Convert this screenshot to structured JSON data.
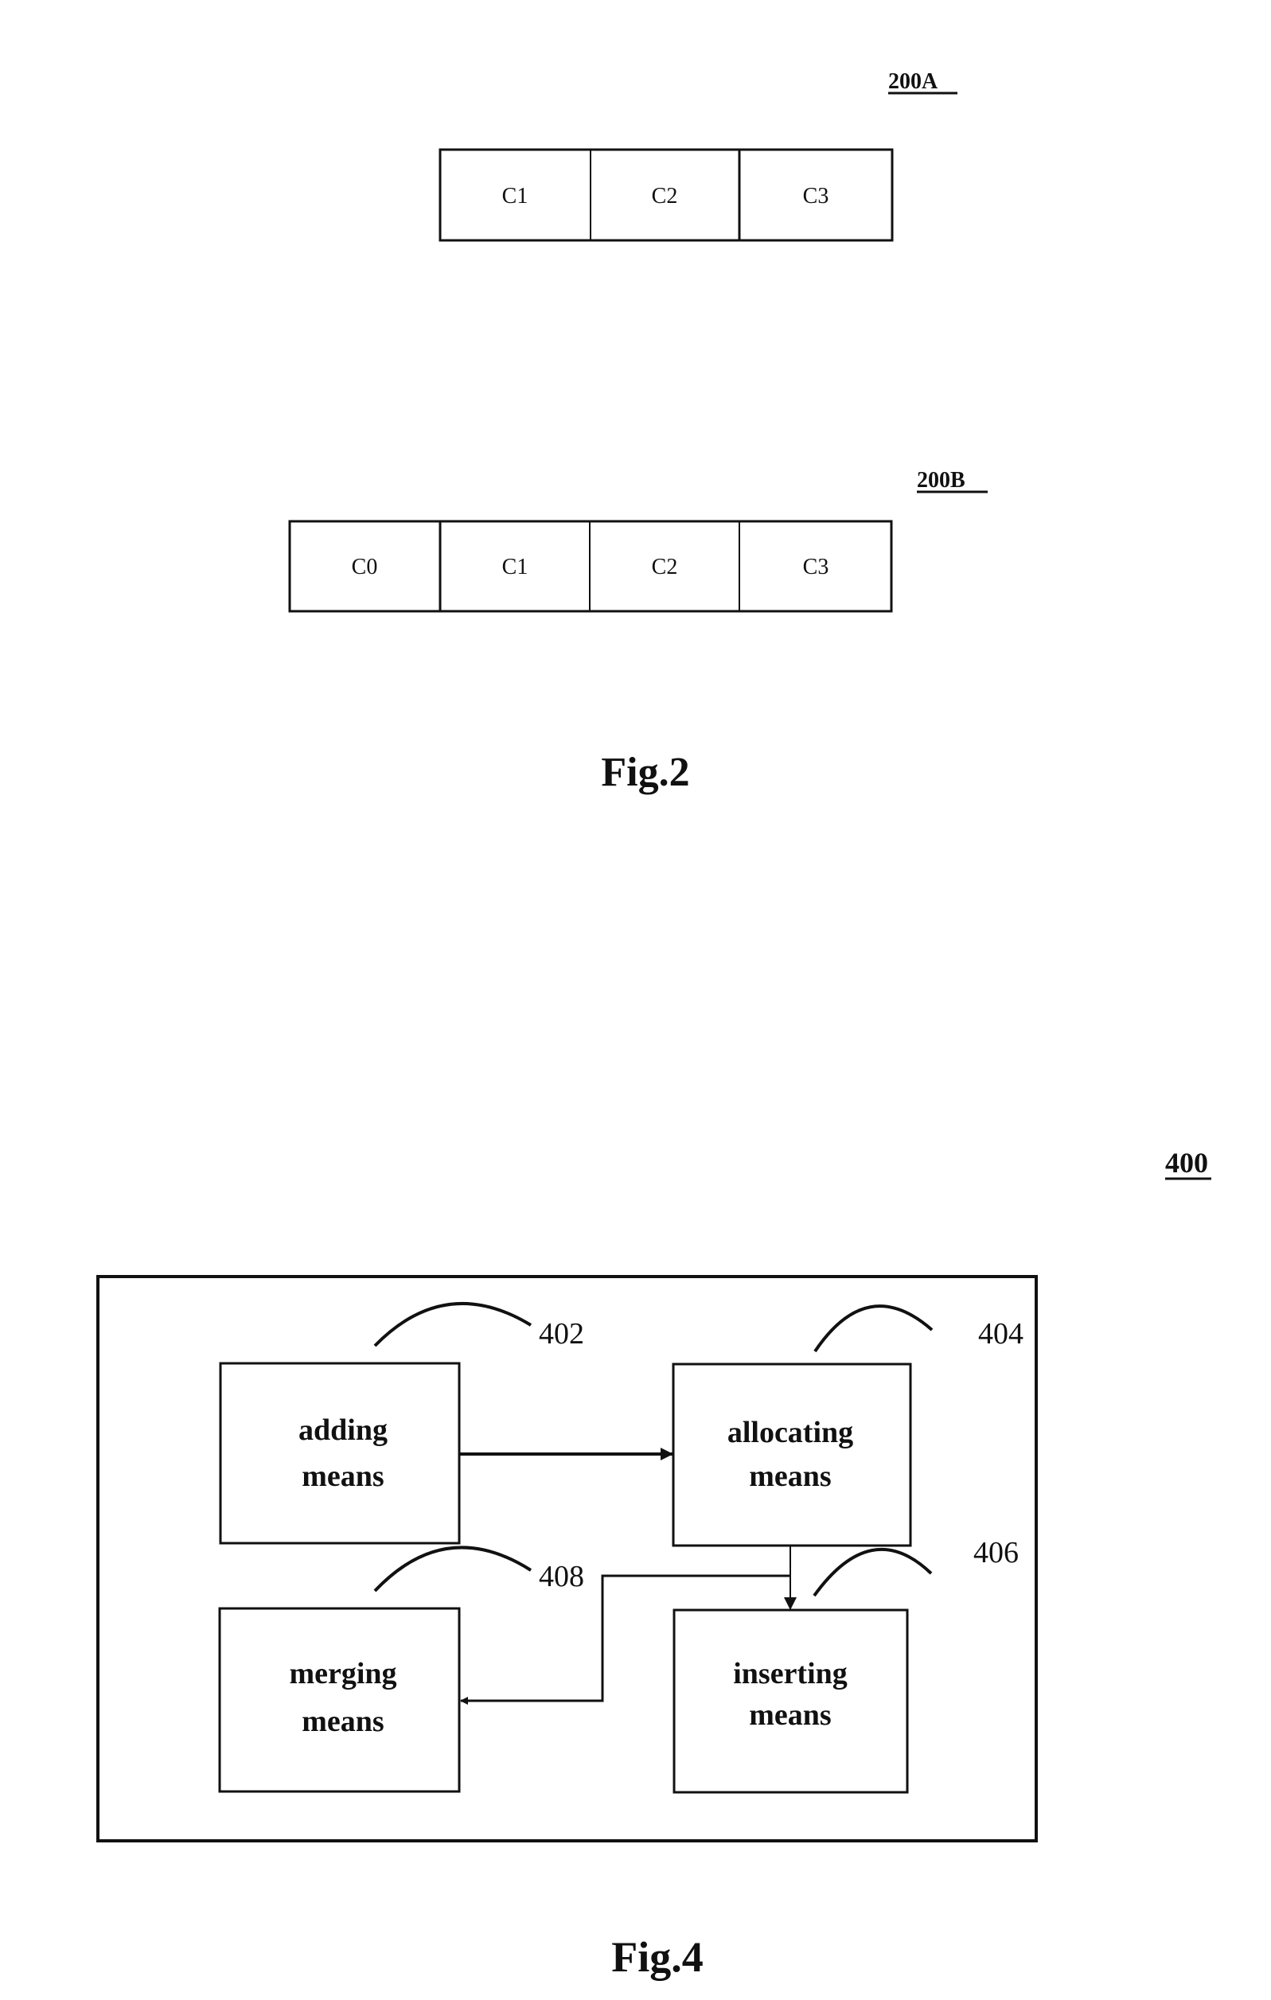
{
  "fig2": {
    "caption": "Fig.2",
    "structure_a": {
      "label": "200A",
      "cells": [
        "C1",
        "C2",
        "C3"
      ]
    },
    "structure_b": {
      "label": "200B",
      "cells": [
        "C0",
        "C1",
        "C2",
        "C3"
      ]
    }
  },
  "fig4": {
    "caption": "Fig.4",
    "label": "400",
    "blocks": {
      "adding": {
        "ref": "402",
        "line1": "adding",
        "line2": "means"
      },
      "allocating": {
        "ref": "404",
        "line1": "allocating",
        "line2": "means"
      },
      "inserting": {
        "ref": "406",
        "line1": "inserting",
        "line2": "means"
      },
      "merging": {
        "ref": "408",
        "line1": "merging",
        "line2": "means"
      }
    },
    "connections": [
      {
        "from": "adding",
        "to": "allocating"
      },
      {
        "from": "allocating",
        "to": "inserting"
      },
      {
        "from": "allocating",
        "to": "merging"
      }
    ]
  },
  "colors": {
    "ink": "#111111",
    "background": "#ffffff"
  }
}
